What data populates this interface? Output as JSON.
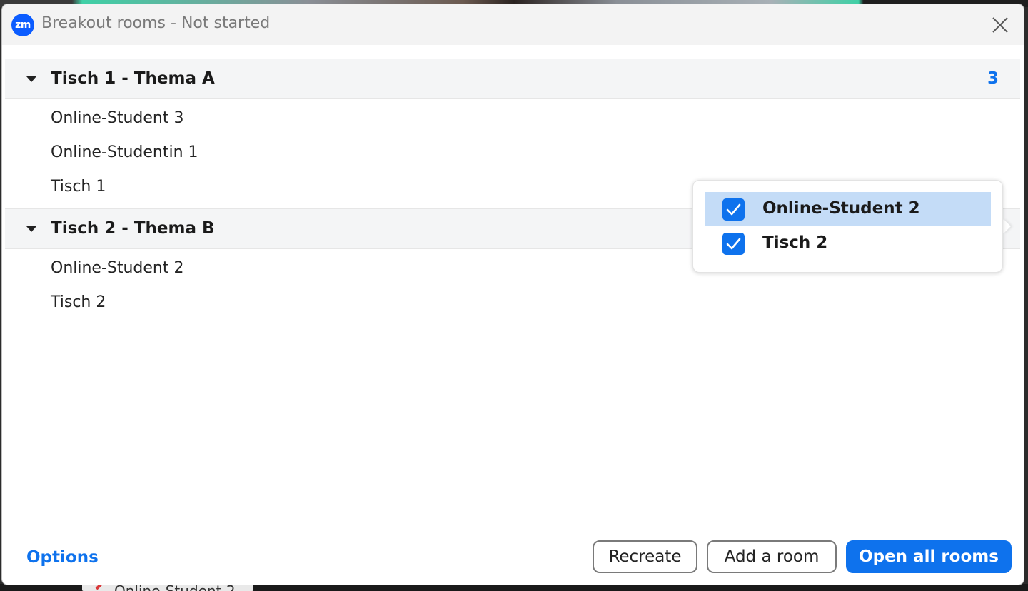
{
  "window": {
    "app_logo_text": "zm",
    "title": "Breakout rooms - Not started"
  },
  "rooms": [
    {
      "name": "Tisch 1 - Thema A",
      "count": "3",
      "participants": [
        "Online-Student 3",
        "Online-Studentin 1",
        "Tisch 1"
      ]
    },
    {
      "name": "Tisch 2 - Thema B",
      "count": "",
      "participants": [
        "Online-Student 2",
        "Tisch 2"
      ]
    }
  ],
  "popup": {
    "items": [
      {
        "label": "Online-Student 2",
        "checked": true,
        "highlighted": true
      },
      {
        "label": "Tisch 2",
        "checked": true,
        "highlighted": false
      }
    ]
  },
  "footer": {
    "options_label": "Options",
    "recreate_label": "Recreate",
    "add_room_label": "Add a room",
    "open_all_label": "Open all rooms"
  },
  "background": {
    "bottom_participant_label": "Online-Student 2"
  },
  "colors": {
    "accent": "#0e72ed",
    "zoom_logo": "#0b5cff",
    "selected_row": "#c4dcf7"
  }
}
